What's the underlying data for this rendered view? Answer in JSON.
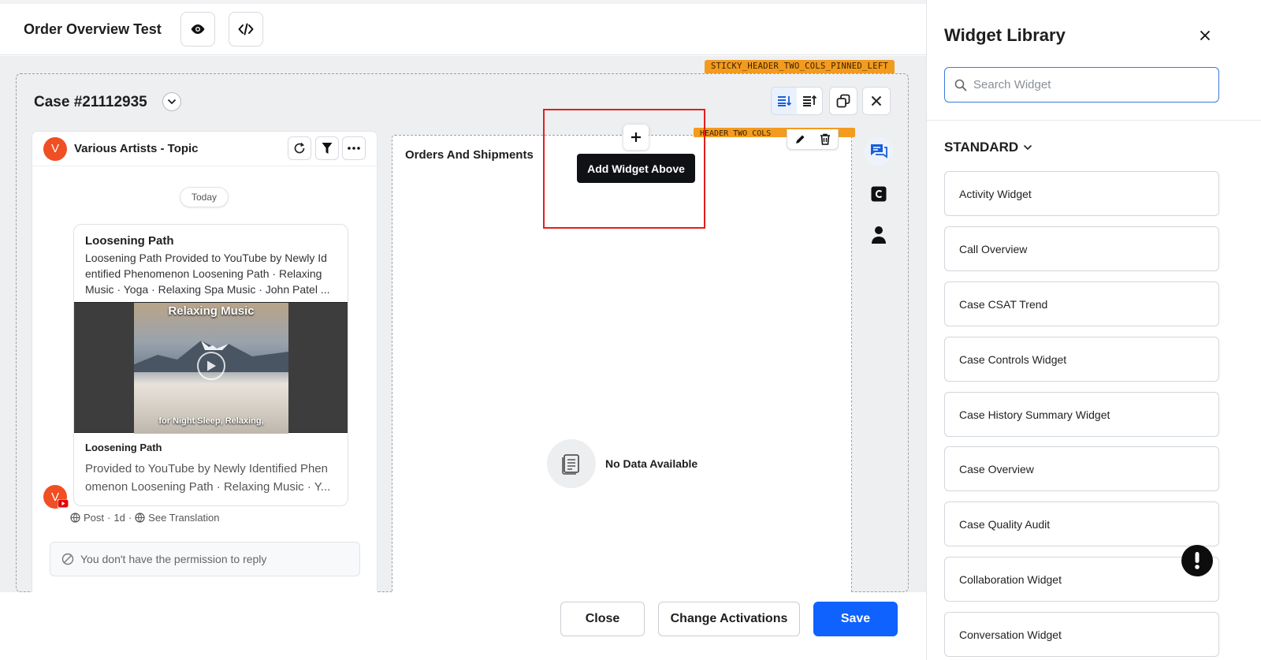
{
  "header": {
    "title": "Order Overview Test",
    "preview_icon": "eye-icon",
    "code_icon": "code-icon"
  },
  "layout_tag": "STICKY_HEADER_TWO_COLS_PINNED_LEFT",
  "section_tag": "HEADER_TWO_COLS",
  "case": {
    "title": "Case #21112935"
  },
  "conversation": {
    "avatar_letter": "V",
    "name": "Various Artists - Topic",
    "date_chip": "Today",
    "post": {
      "title": "Loosening Path",
      "body": "Loosening Path Provided to YouTube by Newly Id entified Phenomenon Loosening Path · Relaxing Music · Yoga · Relaxing Spa Music · John Patel ...",
      "thumb_top": "Relaxing Music",
      "thumb_bottom": "for Night Sleep, Relaxing,",
      "link_title": "Loosening Path",
      "link_desc": "Provided to YouTube by Newly Identified Phen omenon Loosening Path · Relaxing Music · Y..."
    },
    "meta": {
      "type": "Post",
      "age": "1d",
      "translate": "See Translation"
    },
    "no_permission": "You don't have the permission to reply"
  },
  "orders": {
    "title": "Orders And Shipments",
    "tooltip": "Add Widget Above",
    "empty_text": "No Data Available"
  },
  "footer": {
    "close": "Close",
    "change": "Change Activations",
    "save": "Save"
  },
  "library": {
    "title": "Widget Library",
    "search_placeholder": "Search Widget",
    "section": "STANDARD",
    "items": [
      "Activity Widget",
      "Call Overview",
      "Case CSAT Trend",
      "Case Controls Widget",
      "Case History Summary Widget",
      "Case Overview",
      "Case Quality Audit",
      "Collaboration Widget",
      "Conversation Widget"
    ]
  },
  "colors": {
    "accent": "#0f62fe",
    "tag": "#f39b1f",
    "highlight": "#e31e1e",
    "avatar": "#f04e23"
  }
}
